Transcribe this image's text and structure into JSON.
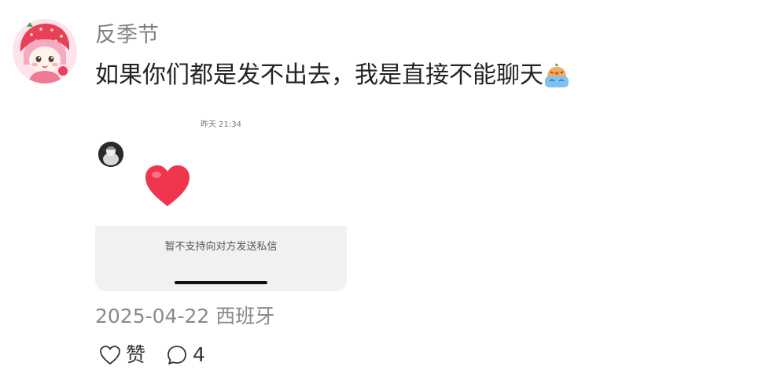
{
  "post": {
    "author": {
      "name": "反季节",
      "avatar_icon": "cartoon-girl-avatar"
    },
    "text": "如果你们都是发不出去，我是直接不能聊天",
    "text_emoji": "crying-emoji-icon",
    "attachment": {
      "timestamp": "昨天 21:34",
      "sender_avatar_icon": "user-avatar-icon",
      "message_emoji": "red-heart-icon",
      "notice": "暂不支持向对方发送私信"
    },
    "date": "2025-04-22",
    "location": "西班牙",
    "actions": {
      "like_label": "赞",
      "like_icon": "heart-outline-icon",
      "comment_count": "4",
      "comment_icon": "comment-bubble-icon"
    }
  },
  "colors": {
    "heart": "#f0364e",
    "notice_bg": "#f1f1f1",
    "meta_text": "#8a8a8a"
  }
}
